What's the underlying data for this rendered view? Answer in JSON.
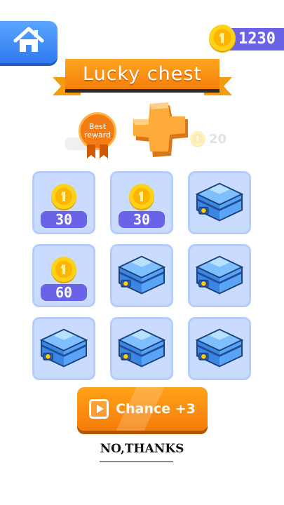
{
  "header": {
    "home_icon": "home-icon",
    "coins": "1230",
    "coin_icon": "coin-icon"
  },
  "title": "Lucky chest",
  "best_reward": {
    "label_line1": "Best",
    "label_line2": "reward",
    "item_icon": "orange-cross-item-icon",
    "faded_value": "20"
  },
  "grid": [
    {
      "type": "coin",
      "amount": "30"
    },
    {
      "type": "coin",
      "amount": "30"
    },
    {
      "type": "chest"
    },
    {
      "type": "coin",
      "amount": "60"
    },
    {
      "type": "chest"
    },
    {
      "type": "chest"
    },
    {
      "type": "chest"
    },
    {
      "type": "chest"
    },
    {
      "type": "chest"
    }
  ],
  "chance_button": {
    "label": "Chance +3",
    "icon": "video-ad-icon"
  },
  "no_thanks": "NO,THANKS",
  "colors": {
    "accent_orange": "#f57f0c",
    "accent_purple": "#6a63e8",
    "cell_bg": "#c9dcff",
    "home_blue": "#2f7af0"
  }
}
